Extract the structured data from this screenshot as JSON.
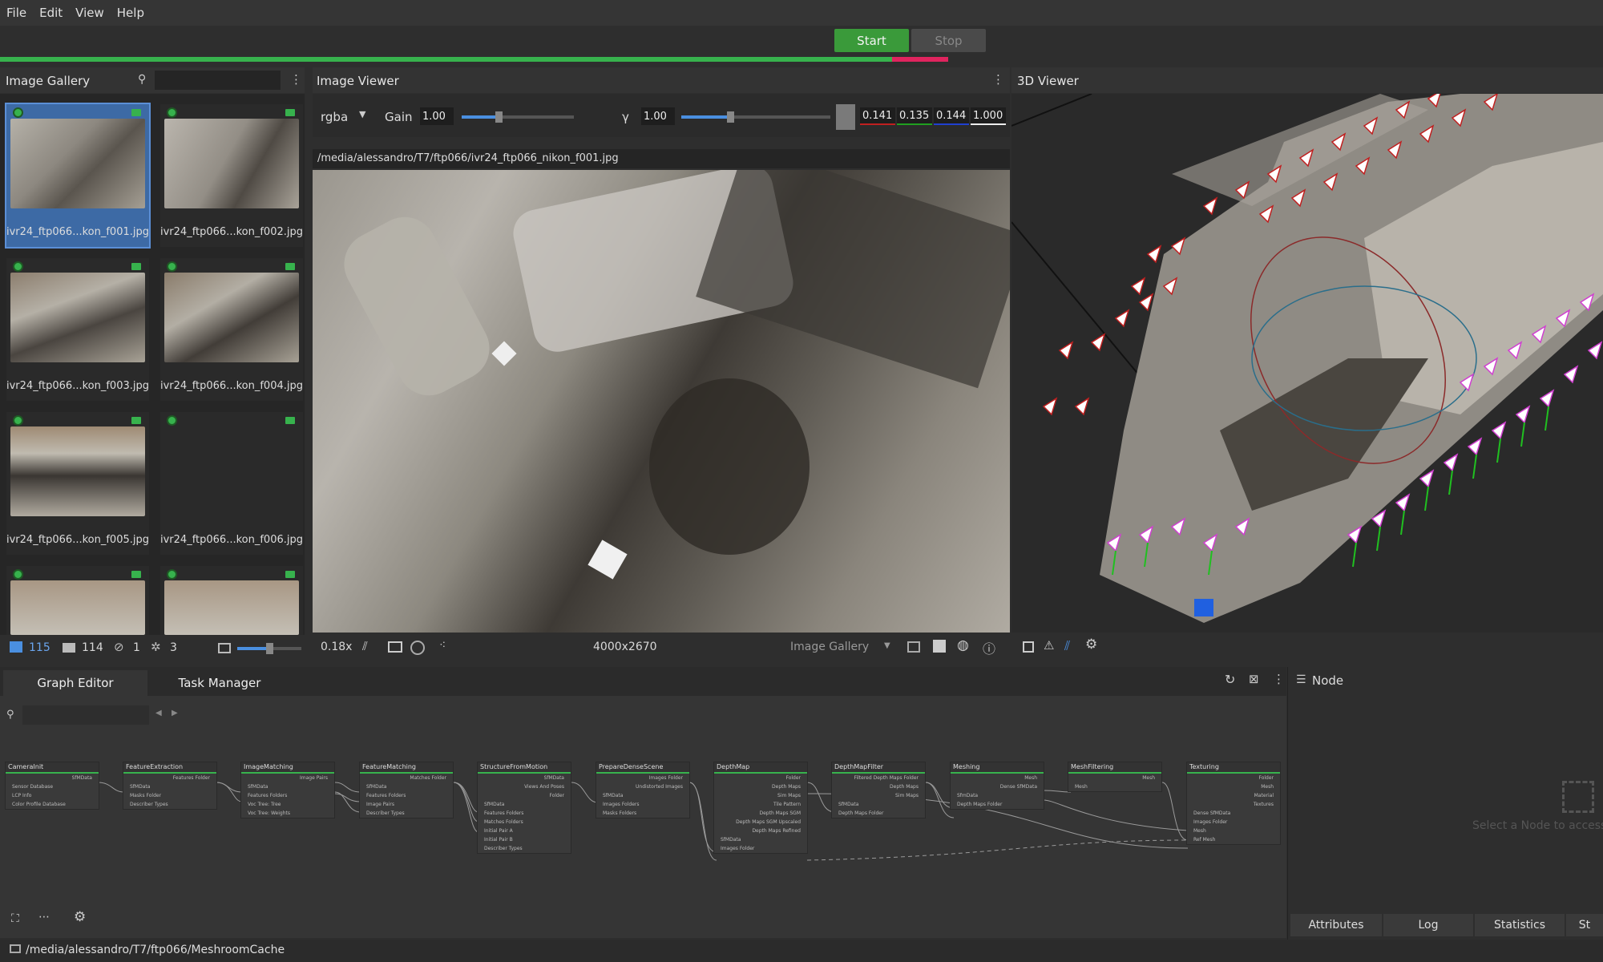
{
  "menu": [
    "File",
    "Edit",
    "View",
    "Help"
  ],
  "toolbar": {
    "start": "Start",
    "stop": "Stop",
    "progress": 0.593
  },
  "gallery": {
    "title": "Image Gallery",
    "search_placeholder": "",
    "images": [
      "ivr24_ftp066...kon_f001.jpg",
      "ivr24_ftp066...kon_f002.jpg",
      "ivr24_ftp066...kon_f003.jpg",
      "ivr24_ftp066...kon_f004.jpg",
      "ivr24_ftp066...kon_f005.jpg",
      "ivr24_ftp066...kon_f006.jpg",
      "",
      ""
    ],
    "stats": {
      "images": "115",
      "cameras": "114",
      "no_intrinsic": "1",
      "rigs": "3"
    }
  },
  "viewer": {
    "title": "Image Viewer",
    "channel": "rgba",
    "gain_label": "Gain",
    "gain": "1.00",
    "gamma_label": "γ",
    "gamma": "1.00",
    "gain_level": 0.33,
    "gamma_level": 0.33,
    "pixel": [
      "0.141",
      "0.135",
      "0.144",
      "1.000"
    ],
    "path": "/media/alessandro/T7/ftp066/ivr24_ftp066_nikon_f001.jpg",
    "zoom": "0.18x",
    "resolution": "4000x2670",
    "source": "Image Gallery"
  },
  "viewer3d": {
    "title": "3D Viewer"
  },
  "tabs": {
    "graph": "Graph Editor",
    "tasks": "Task Manager"
  },
  "graph": {
    "search_placeholder": "",
    "nodes": [
      {
        "name": "CameraInit",
        "in": [
          "Sensor Database",
          "LCP Info",
          "Color Profile Database"
        ],
        "out": [
          "SfMData"
        ]
      },
      {
        "name": "FeatureExtraction",
        "in": [
          "SfMData",
          "Masks Folder",
          "Describer Types"
        ],
        "out": [
          "Features Folder"
        ]
      },
      {
        "name": "ImageMatching",
        "in": [
          "SfMData",
          "Features Folders",
          "Voc Tree: Tree",
          "Voc Tree: Weights"
        ],
        "out": [
          "Image Pairs"
        ]
      },
      {
        "name": "FeatureMatching",
        "in": [
          "SfMData",
          "Features Folders",
          "Image Pairs",
          "Describer Types"
        ],
        "out": [
          "Matches Folder"
        ]
      },
      {
        "name": "StructureFromMotion",
        "in": [
          "SfMData",
          "Features Folders",
          "Matches Folders",
          "Initial Pair A",
          "Initial Pair B",
          "Describer Types"
        ],
        "out": [
          "SfMData",
          "Views And Poses",
          "Folder"
        ]
      },
      {
        "name": "PrepareDenseScene",
        "in": [
          "SfMData",
          "Images Folders",
          "Masks Folders"
        ],
        "out": [
          "Images Folder",
          "Undistorted Images"
        ]
      },
      {
        "name": "DepthMap",
        "in": [
          "SfMData",
          "Images Folder"
        ],
        "out": [
          "Folder",
          "Depth Maps",
          "Sim Maps",
          "Tile Pattern",
          "Depth Maps SGM",
          "Depth Maps SGM Upscaled",
          "Depth Maps Refined"
        ]
      },
      {
        "name": "DepthMapFilter",
        "in": [
          "SfMData",
          "Depth Maps Folder"
        ],
        "out": [
          "Filtered Depth Maps Folder",
          "Depth Maps",
          "Sim Maps"
        ]
      },
      {
        "name": "Meshing",
        "in": [
          "SfmData",
          "Depth Maps Folder"
        ],
        "out": [
          "Mesh",
          "Dense SfMData"
        ]
      },
      {
        "name": "MeshFiltering",
        "in": [
          "Mesh"
        ],
        "out": [
          "Mesh"
        ]
      },
      {
        "name": "Texturing",
        "in": [
          "Dense SfMData",
          "Images Folder",
          "Mesh",
          "Ref Mesh"
        ],
        "out": [
          "Folder",
          "Mesh",
          "Material",
          "Textures"
        ]
      }
    ]
  },
  "node_panel": {
    "title": "Node",
    "hint": "Select a Node to access",
    "tabs": [
      "Attributes",
      "Log",
      "Statistics",
      "St"
    ]
  },
  "status": {
    "path": "/media/alessandro/T7/ftp066/MeshroomCache"
  }
}
